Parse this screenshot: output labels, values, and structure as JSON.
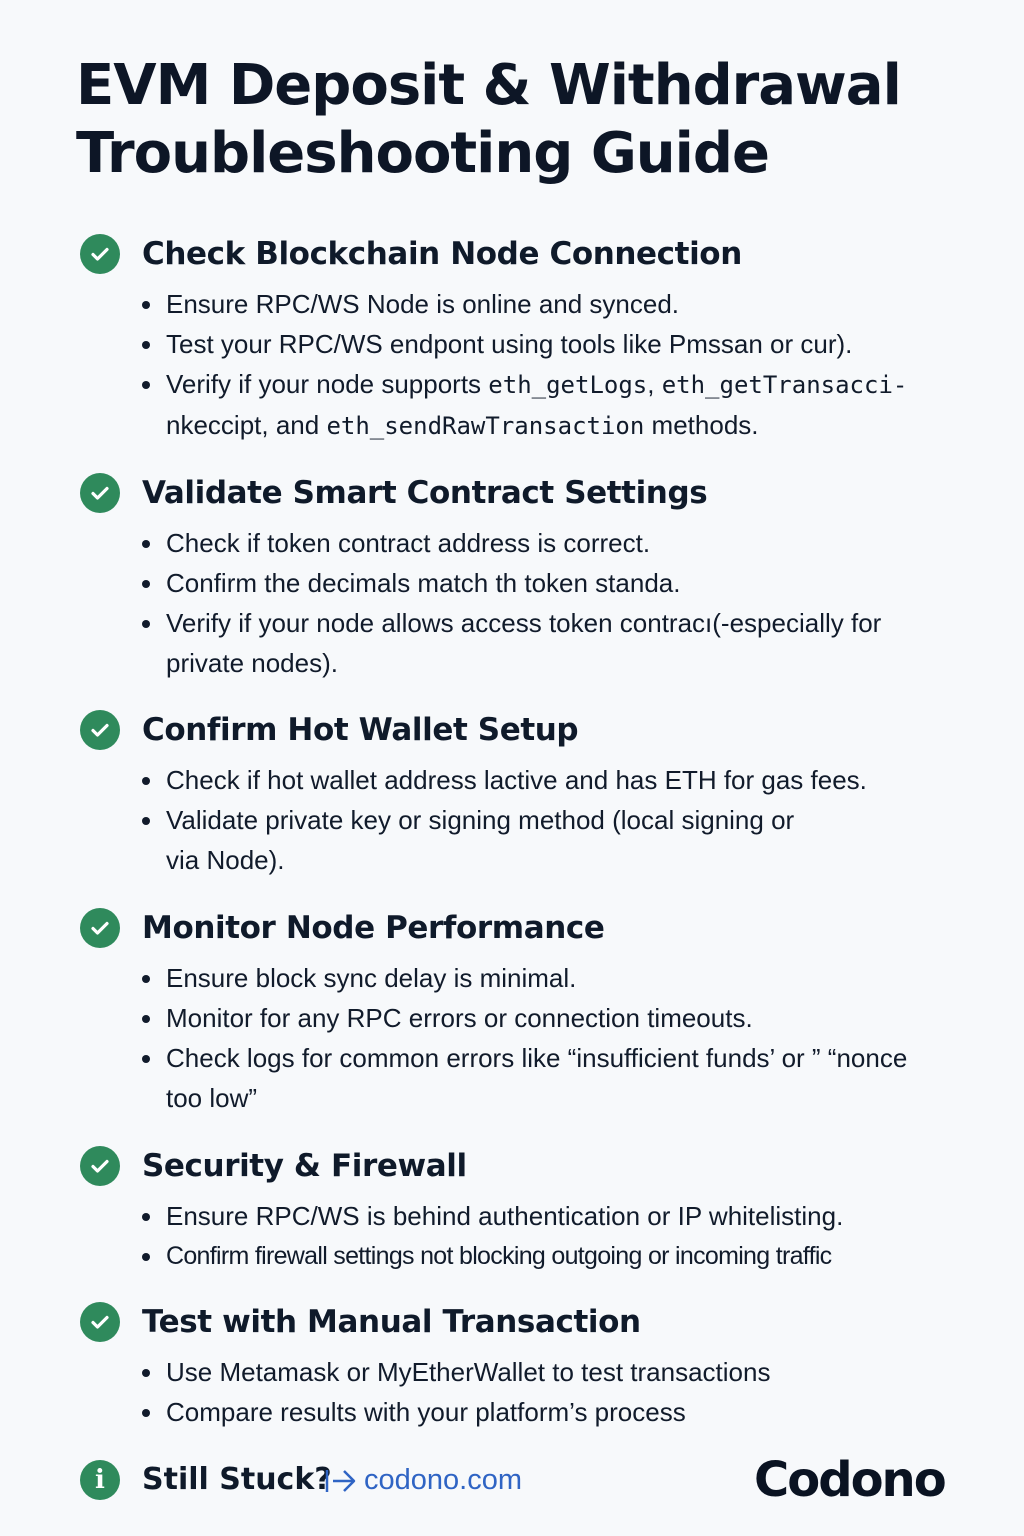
{
  "title": {
    "line1": "EVM Deposit & Withdrawal",
    "line2": "Troubleshooting Guide"
  },
  "sections": [
    {
      "icon": "check-circle-icon",
      "title": "Check Blockchain Node Connection",
      "items": [
        {
          "text": "Ensure RPC/WS Node is online and synced."
        },
        {
          "text": "Test your RPC/WS endpont using tools like Pmssan or cur)."
        },
        {
          "a": "Verify if your node supports ",
          "m1": "eth_getLogs",
          "b": ", ",
          "m2": "eth_getTransacci‑",
          "c": " nkeccipt, and ",
          "m3": "eth_sendRawTransaction",
          "d": " methods."
        }
      ]
    },
    {
      "icon": "check-circle-icon",
      "title": "Validate Smart Contract Settings",
      "items": [
        {
          "text": "Check if token contract address is correct."
        },
        {
          "text": "Confirm the decimals match th token standa."
        },
        {
          "text": "Verify if your node allows access token contracı(-especially for private nodes)."
        }
      ]
    },
    {
      "icon": "check-circle-icon",
      "title": "Confirm Hot Wallet Setup",
      "items": [
        {
          "text": "Check if hot wallet address lactive and has ETH for gas fees."
        },
        {
          "text": "Validate private key or signing method (local signing or via Node)."
        }
      ]
    },
    {
      "icon": "check-circle-icon",
      "title": "Monitor Node Performance",
      "items": [
        {
          "text": "Ensure block sync delay is minimal."
        },
        {
          "text": "Monitor for any RPC errors or connection timeouts."
        },
        {
          "text": "Check logs for common errors like “insufficient funds’ or ” “nonce too low”"
        }
      ]
    },
    {
      "icon": "check-circle-icon",
      "title": "Security & Firewall",
      "items": [
        {
          "text": "Ensure RPC/WS is behind authentication or IP whitelisting."
        },
        {
          "text": "Confirm firewall settings not blocking outgoing or incoming traffic"
        }
      ]
    },
    {
      "icon": "check-circle-icon",
      "title": "Test with Manual Transaction",
      "items": [
        {
          "text": "Use Metamask or MyEtherWallet to test transactions"
        },
        {
          "text": "Compare results with your platform’s process"
        }
      ]
    }
  ],
  "footer": {
    "icon": "info-circle-icon",
    "info_glyph": "i",
    "label": "Still Stuck?",
    "arrow_icon": "arrow-right-icon",
    "link": "codono.com",
    "brand": "Codono"
  },
  "colors": {
    "accent_green": "#2f8a5c",
    "link_blue": "#2f64c4",
    "text_dark": "#0f1a2a",
    "background": "#f7f9fb"
  }
}
